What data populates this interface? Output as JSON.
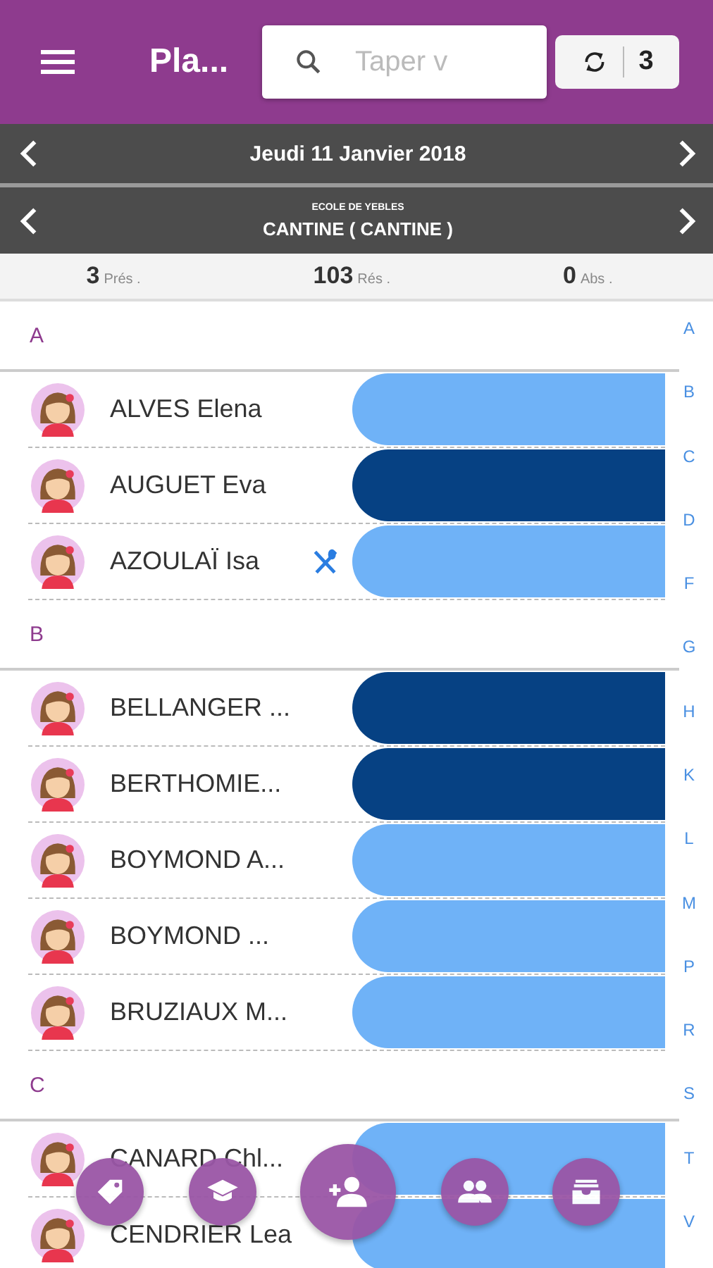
{
  "header": {
    "title": "Pla...",
    "search": {
      "placeholder": "Taper v"
    },
    "sync_count": "3"
  },
  "date_bar": {
    "label": "Jeudi 11 Janvier 2018"
  },
  "place_bar": {
    "school": "ECOLE DE YEBLES",
    "activity": "CANTINE ( CANTINE )"
  },
  "stats": [
    {
      "count": "3",
      "label": "Prés ."
    },
    {
      "count": "103",
      "label": "Rés ."
    },
    {
      "count": "0",
      "label": "Abs ."
    }
  ],
  "sections": [
    {
      "letter": "A",
      "rows": [
        {
          "name": "ALVES Elena",
          "present": false,
          "meal": false
        },
        {
          "name": "AUGUET Eva",
          "present": true,
          "meal": false
        },
        {
          "name": "AZOULAÏ Isa",
          "present": false,
          "meal": true
        }
      ]
    },
    {
      "letter": "B",
      "rows": [
        {
          "name": "BELLANGER ...",
          "present": true,
          "meal": false
        },
        {
          "name": "BERTHOMIE...",
          "present": true,
          "meal": false
        },
        {
          "name": "BOYMOND A...",
          "present": false,
          "meal": false
        },
        {
          "name": "BOYMOND ...",
          "present": false,
          "meal": false
        },
        {
          "name": "BRUZIAUX M...",
          "present": false,
          "meal": false
        }
      ]
    },
    {
      "letter": "C",
      "rows": [
        {
          "name": "CANARD Chl...",
          "present": false,
          "meal": false
        },
        {
          "name": "CENDRIER Lea",
          "present": false,
          "meal": false
        }
      ]
    }
  ],
  "index_letters": [
    "A",
    "B",
    "C",
    "D",
    "F",
    "G",
    "H",
    "K",
    "L",
    "M",
    "P",
    "R",
    "S",
    "T",
    "V"
  ],
  "actions": [
    {
      "kind": "tag"
    },
    {
      "kind": "cap"
    },
    {
      "kind": "add-person"
    },
    {
      "kind": "group"
    },
    {
      "kind": "archive"
    }
  ]
}
